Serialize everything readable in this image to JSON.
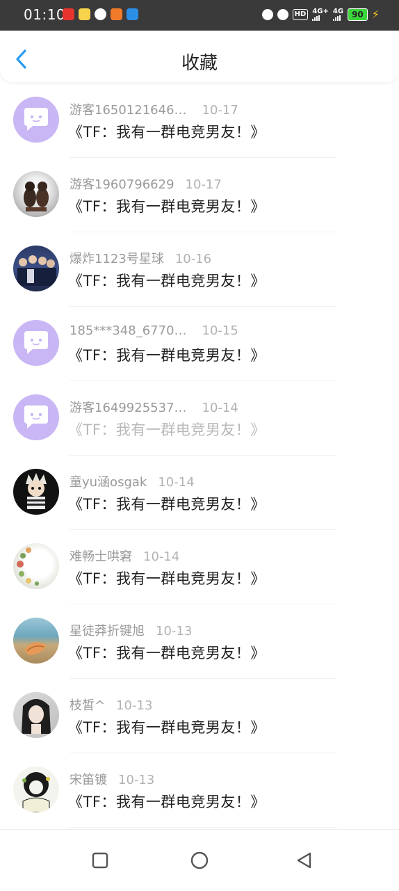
{
  "status_bar": {
    "time": "01:10",
    "battery": "90",
    "network_label": "4G+",
    "network_label_2": "4G",
    "hd_label": "HD"
  },
  "header": {
    "title": "收藏"
  },
  "items": [
    {
      "name": "游客1650121646…",
      "date": "10-17",
      "message": "《TF：我有一群电竞男友！》",
      "avatar": "default"
    },
    {
      "name": "游客1960796629",
      "date": "10-17",
      "message": "《TF：我有一群电竞男友！》",
      "avatar": "figurine"
    },
    {
      "name": "爆炸1123号星球",
      "date": "10-16",
      "message": "《TF：我有一群电竞男友！》",
      "avatar": "group"
    },
    {
      "name": "185***348_6770…",
      "date": "10-15",
      "message": "《TF：我有一群电竞男友！》",
      "avatar": "default"
    },
    {
      "name": "游客1649925537…",
      "date": "10-14",
      "message": "《TF：我有一群电竞男友！》",
      "avatar": "default",
      "faded": true
    },
    {
      "name": "童yu涵osgak",
      "date": "10-14",
      "message": "《TF：我有一群电竞男友！》",
      "avatar": "cartoon"
    },
    {
      "name": "难畅士哄窘",
      "date": "10-14",
      "message": "《TF：我有一群电竞男友！》",
      "avatar": "flower"
    },
    {
      "name": "星徒莽折键旭",
      "date": "10-13",
      "message": "《TF：我有一群电竞男友！》",
      "avatar": "beach"
    },
    {
      "name": "枝皙^",
      "date": "10-13",
      "message": "《TF：我有一群电竞男友！》",
      "avatar": "portrait"
    },
    {
      "name": "宋笛镀",
      "date": "10-13",
      "message": "《TF：我有一群电竞男友！》",
      "avatar": "sketch"
    }
  ],
  "colors": {
    "accent": "#2a9df4",
    "default_avatar": "#c9b6f5",
    "status_bar": "#3a3a3a"
  },
  "icons": {
    "back": "chevron-left-icon",
    "nav_recent": "square-icon",
    "nav_home": "circle-icon",
    "nav_back": "triangle-back-icon"
  }
}
